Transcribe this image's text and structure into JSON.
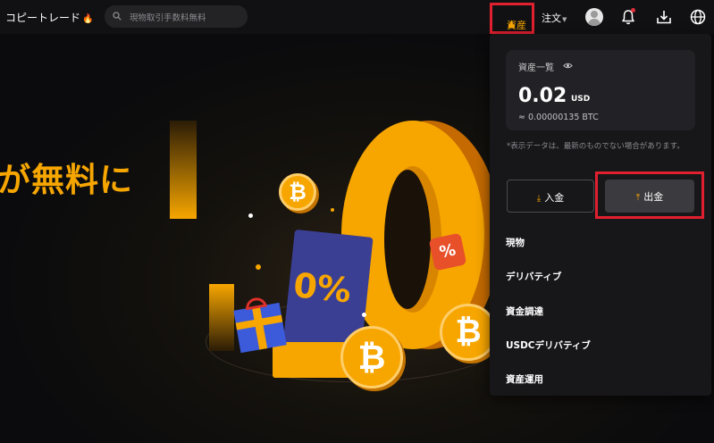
{
  "header": {
    "brand": "コピートレード",
    "search": {
      "placeholder": "現物取引手数料無料"
    },
    "nav": {
      "assets": "資産",
      "orders": "注文"
    },
    "colors": {
      "accent": "#f7a600",
      "highlight": "#e0202e"
    }
  },
  "hero": {
    "headline": "が無料に",
    "badge_percent": "0%",
    "bubble_percent": "%"
  },
  "asset_panel": {
    "card_title": "資産一覧",
    "amount": "0.02",
    "currency": "USD",
    "btc_equivalent": "≈ 0.00000135 BTC",
    "note": "*表示データは、最新のものでない場合があります。",
    "deposit_label": "入金",
    "withdraw_label": "出金",
    "menu": [
      {
        "label": "現物"
      },
      {
        "label": "デリバティブ"
      },
      {
        "label": "資金調達"
      },
      {
        "label": "USDCデリバティブ"
      },
      {
        "label": "資産運用"
      }
    ]
  },
  "icons": [
    "search-icon",
    "flame-icon",
    "avatar-icon",
    "bell-icon",
    "download-icon",
    "globe-icon",
    "eye-icon",
    "deposit-icon",
    "withdraw-icon"
  ]
}
